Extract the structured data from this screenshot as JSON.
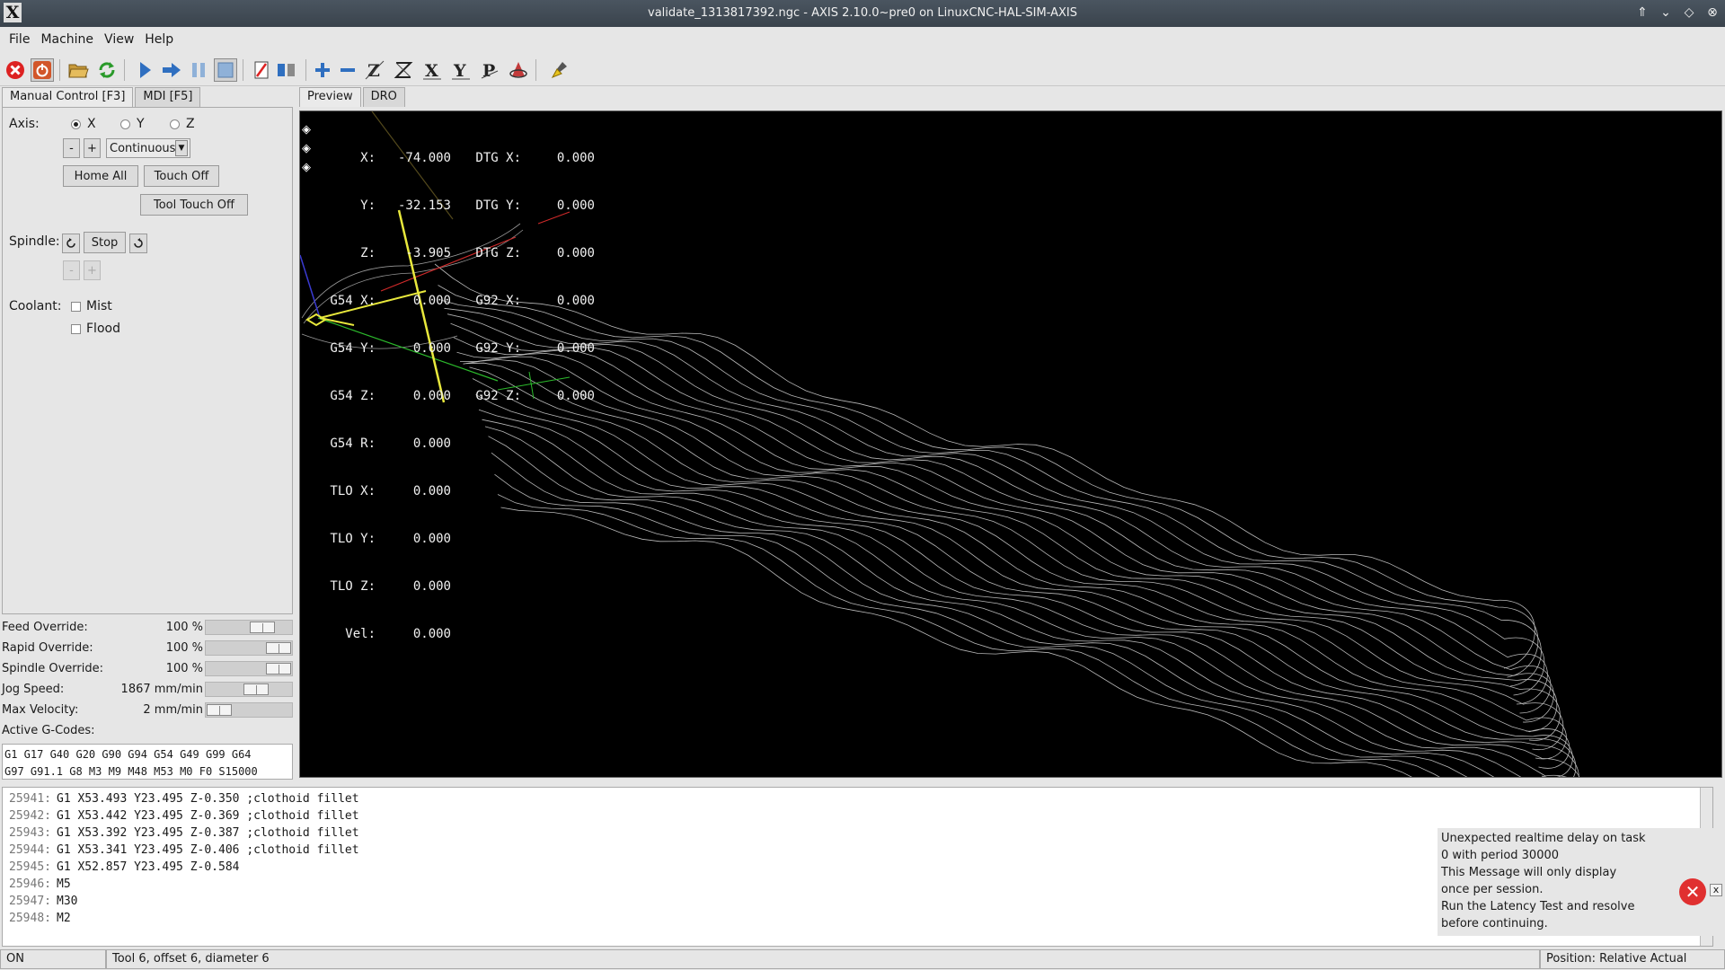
{
  "window": {
    "title": "validate_1313817392.ngc - AXIS 2.10.0~pre0 on LinuxCNC-HAL-SIM-AXIS"
  },
  "menu": [
    "File",
    "Machine",
    "View",
    "Help"
  ],
  "toolbar_icons": [
    "estop-icon",
    "machine-power-icon",
    "open-file-icon",
    "reload-icon",
    "run-icon",
    "step-icon",
    "pause-icon",
    "stop-icon",
    "block-delete-icon",
    "optional-stop-icon",
    "zoom-in-icon",
    "zoom-out-icon",
    "view-z-icon",
    "view-z2-icon",
    "view-x-icon",
    "view-y-icon",
    "view-p-icon",
    "rotate-icon",
    "clear-plot-icon"
  ],
  "left_tabs": [
    "Manual Control [F3]",
    "MDI [F5]"
  ],
  "manual": {
    "axis_label": "Axis:",
    "axes": [
      "X",
      "Y",
      "Z"
    ],
    "selected_axis": "X",
    "jog_minus": "-",
    "jog_plus": "+",
    "jog_mode": "Continuous",
    "home_all": "Home All",
    "touch_off": "Touch Off",
    "tool_touch_off": "Tool Touch Off",
    "spindle_label": "Spindle:",
    "spindle_stop": "Stop",
    "spindle_minus": "-",
    "spindle_plus": "+",
    "coolant_label": "Coolant:",
    "mist": "Mist",
    "flood": "Flood"
  },
  "overrides": [
    {
      "name": "Feed Override:",
      "value": "100 %",
      "level": 0.72
    },
    {
      "name": "Rapid Override:",
      "value": "100 %",
      "level": 1.0
    },
    {
      "name": "Spindle Override:",
      "value": "100 %",
      "level": 1.0
    },
    {
      "name": "Jog Speed:",
      "value": "1867 mm/min",
      "level": 0.62
    },
    {
      "name": "Max Velocity:",
      "value": "2 mm/min",
      "level": 0.0
    }
  ],
  "active_gcodes_label": "Active G-Codes:",
  "active_gcodes": [
    "G1 G17 G40 G20 G90 G94 G54 G49 G99 G64",
    "G97 G91.1 G8 M3 M9 M48 M53 M0 F0 S15000"
  ],
  "preview_tabs": [
    "Preview",
    "DRO"
  ],
  "dro": [
    {
      "l1": "X:",
      "v1": "-74.000",
      "l2": "DTG X:",
      "v2": "0.000"
    },
    {
      "l1": "Y:",
      "v1": "-32.153",
      "l2": "DTG Y:",
      "v2": "0.000"
    },
    {
      "l1": "Z:",
      "v1": "-3.905",
      "l2": "DTG Z:",
      "v2": "0.000"
    },
    {
      "l1": "G54 X:",
      "v1": "0.000",
      "l2": "G92 X:",
      "v2": "0.000"
    },
    {
      "l1": "G54 Y:",
      "v1": "0.000",
      "l2": "G92 Y:",
      "v2": "0.000"
    },
    {
      "l1": "G54 Z:",
      "v1": "0.000",
      "l2": "G92 Z:",
      "v2": "0.000"
    },
    {
      "l1": "G54 R:",
      "v1": "0.000",
      "l2": "",
      "v2": ""
    },
    {
      "l1": "TLO X:",
      "v1": "0.000",
      "l2": "",
      "v2": ""
    },
    {
      "l1": "TLO Y:",
      "v1": "0.000",
      "l2": "",
      "v2": ""
    },
    {
      "l1": "TLO Z:",
      "v1": "0.000",
      "l2": "",
      "v2": ""
    },
    {
      "l1": "Vel:",
      "v1": "0.000",
      "l2": "",
      "v2": ""
    }
  ],
  "gcode_lines": [
    {
      "n": "25941:",
      "code": "G1 X53.493 Y23.495 Z-0.350 ;clothoid fillet"
    },
    {
      "n": "25942:",
      "code": "G1 X53.442 Y23.495 Z-0.369 ;clothoid fillet"
    },
    {
      "n": "25943:",
      "code": "G1 X53.392 Y23.495 Z-0.387 ;clothoid fillet"
    },
    {
      "n": "25944:",
      "code": "G1 X53.341 Y23.495 Z-0.406 ;clothoid fillet"
    },
    {
      "n": "25945:",
      "code": "G1 X52.857 Y23.495 Z-0.584"
    },
    {
      "n": "25946:",
      "code": "M5"
    },
    {
      "n": "25947:",
      "code": "M30"
    },
    {
      "n": "25948:",
      "code": "M2"
    }
  ],
  "notification": {
    "lines": [
      "Unexpected realtime delay on task 0 with period 30000",
      "This Message will only display once per session.",
      "Run the Latency Test and resolve before continuing."
    ],
    "close": "x"
  },
  "status": {
    "state": "ON",
    "tool": "Tool 6, offset 6, diameter 6",
    "position": "Position: Relative Actual"
  }
}
